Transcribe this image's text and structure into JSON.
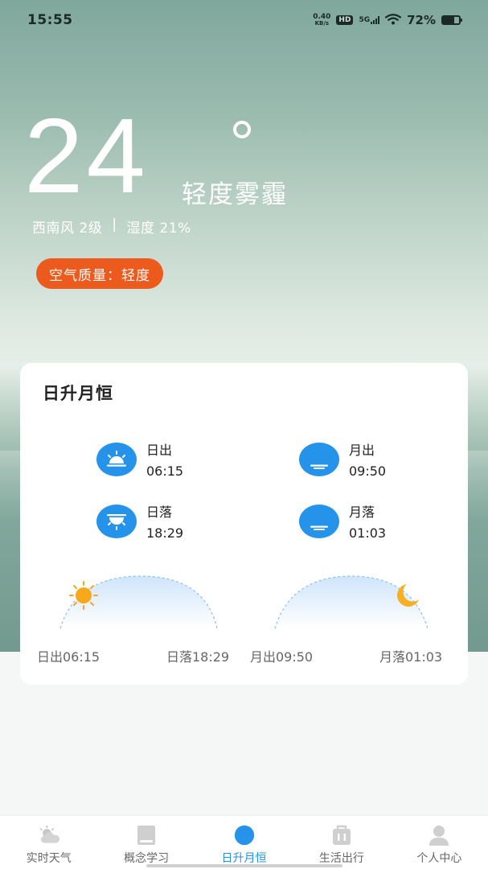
{
  "status_bar": {
    "time": "15:55",
    "net_speed_value": "0.40",
    "net_speed_unit": "KB/s",
    "hd": "HD",
    "network": "5G",
    "battery_pct": "72%",
    "battery_level": 0.72
  },
  "weather": {
    "temperature": "24",
    "description": "轻度雾霾",
    "wind": "西南风 2级",
    "separator": "|",
    "humidity": "湿度 21%",
    "air_quality": "空气质量：轻度"
  },
  "card": {
    "title": "日升月恒",
    "sunrise_label": "日出",
    "sunrise_time": "06:15",
    "moonrise_label": "月出",
    "moonrise_time": "09:50",
    "sunset_label": "日落",
    "sunset_time": "18:29",
    "moonset_label": "月落",
    "moonset_time": "01:03",
    "arc_sunrise": "日出06:15",
    "arc_sunset": "日落18:29",
    "arc_moonrise": "月出09:50",
    "arc_moonset": "月落01:03"
  },
  "nav": {
    "items": [
      {
        "label": "实时天气",
        "icon": "weather-icon"
      },
      {
        "label": "概念学习",
        "icon": "book-icon"
      },
      {
        "label": "日升月恒",
        "icon": "moon-icon",
        "active": true
      },
      {
        "label": "生活出行",
        "icon": "bag-icon"
      },
      {
        "label": "个人中心",
        "icon": "person-icon"
      }
    ]
  },
  "colors": {
    "accent": "#2593ea",
    "badge": "#ec5a1d"
  }
}
